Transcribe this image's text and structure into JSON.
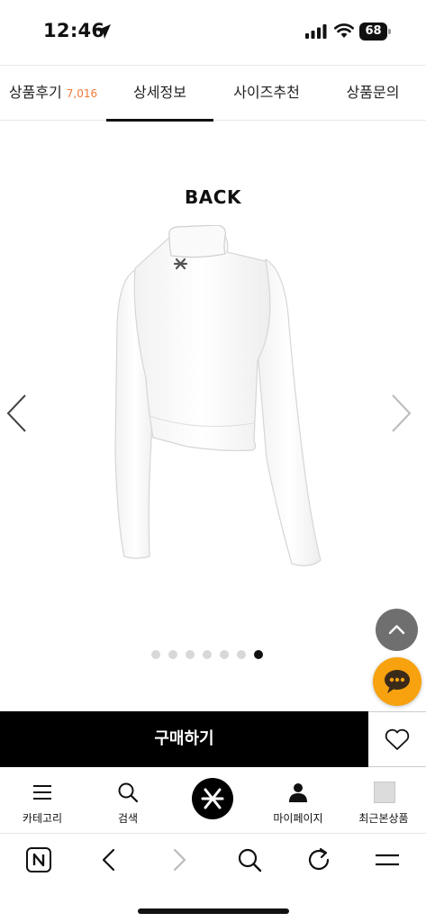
{
  "status_bar": {
    "time": "12:46",
    "battery": "68",
    "battery_level": 0.68,
    "icons": [
      "location-arrow-icon",
      "cellular-signal-icon",
      "wifi-icon",
      "battery-icon"
    ]
  },
  "tabs": [
    {
      "label": "상품후기",
      "count": "7,016",
      "active": false
    },
    {
      "label": "상세정보",
      "active": true
    },
    {
      "label": "사이즈추천",
      "active": false
    },
    {
      "label": "상품문의",
      "active": false
    }
  ],
  "gallery": {
    "title": "BACK",
    "total_slides": 7,
    "current_slide": 7,
    "prev_icon": "chevron-left-icon",
    "next_icon": "chevron-right-icon"
  },
  "floating": {
    "scroll_top_icon": "chevron-up-icon",
    "chat_icon": "chat-bubble-icon"
  },
  "purchase": {
    "buy_label": "구매하기",
    "wish_icon": "heart-icon"
  },
  "app_nav": {
    "items": [
      {
        "label": "카테고리",
        "icon": "menu-icon"
      },
      {
        "label": "검색",
        "icon": "search-icon"
      },
      {
        "label": "",
        "icon": "brand-logo-icon"
      },
      {
        "label": "마이페이지",
        "icon": "person-icon"
      },
      {
        "label": "최근본상품",
        "icon": "recent-thumbnail"
      }
    ]
  },
  "browser_toolbar": {
    "icons": [
      "naver-home-icon",
      "back-icon",
      "forward-icon",
      "search-icon",
      "reload-icon",
      "menu-icon"
    ]
  },
  "colors": {
    "accent_count": "#f07a3a",
    "chat": "#f7a20e",
    "buy_button": "#000000"
  }
}
